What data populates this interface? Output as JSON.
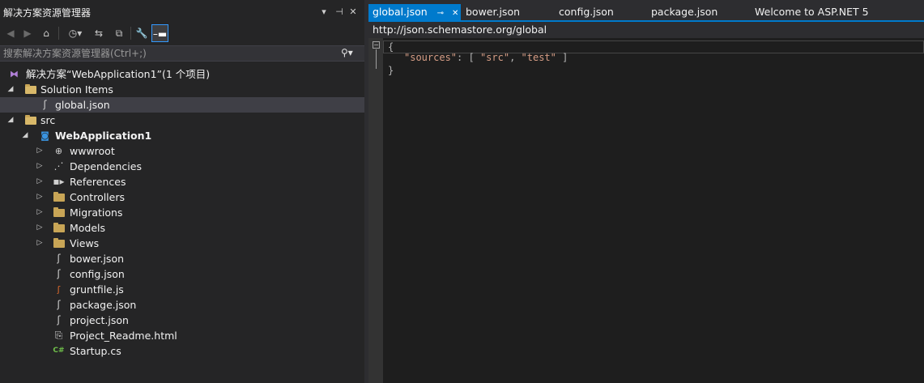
{
  "solution_explorer": {
    "title": "解决方案资源管理器",
    "title_controls": {
      "dropdown": "▾",
      "pin": "⊣",
      "close": "✕"
    },
    "search_placeholder": "搜索解决方案资源管理器(Ctrl+;)",
    "tree": {
      "solution": "解决方案“WebApplication1”(1 个项目)",
      "solution_items": "Solution Items",
      "global_json": "global.json",
      "src": "src",
      "project": "WebApplication1",
      "children": [
        {
          "label": "wwwroot",
          "icon": "globe-icon"
        },
        {
          "label": "Dependencies",
          "icon": "dependencies-icon"
        },
        {
          "label": "References",
          "icon": "references-icon"
        },
        {
          "label": "Controllers",
          "icon": "folder-icon"
        },
        {
          "label": "Migrations",
          "icon": "folder-icon"
        },
        {
          "label": "Models",
          "icon": "folder-icon"
        },
        {
          "label": "Views",
          "icon": "folder-icon"
        },
        {
          "label": "bower.json",
          "icon": "json-file-icon"
        },
        {
          "label": "config.json",
          "icon": "json-file-icon"
        },
        {
          "label": "gruntfile.js",
          "icon": "js-file-icon"
        },
        {
          "label": "package.json",
          "icon": "json-file-icon"
        },
        {
          "label": "project.json",
          "icon": "json-file-icon"
        },
        {
          "label": "Project_Readme.html",
          "icon": "html-file-icon"
        },
        {
          "label": "Startup.cs",
          "icon": "csharp-file-icon"
        }
      ]
    }
  },
  "editor": {
    "tabs": [
      {
        "label": "global.json",
        "active": true
      },
      {
        "label": "bower.json"
      },
      {
        "label": "config.json"
      },
      {
        "label": "package.json"
      },
      {
        "label": "Welcome to ASP.NET 5"
      }
    ],
    "tab_controls": {
      "pin": "⊸",
      "close": "✕"
    },
    "schema_url": "http://json.schemastore.org/global",
    "code": {
      "open_brace": "{",
      "key": "\"sources\"",
      "colon": ": [ ",
      "v1": "\"src\"",
      "comma": ", ",
      "v2": "\"test\"",
      "close_bracket": " ]",
      "close_brace": "}"
    }
  },
  "colors": {
    "accent": "#007acc",
    "panel": "#252526",
    "editor_bg": "#1e1e1e",
    "string": "#d69d85"
  }
}
